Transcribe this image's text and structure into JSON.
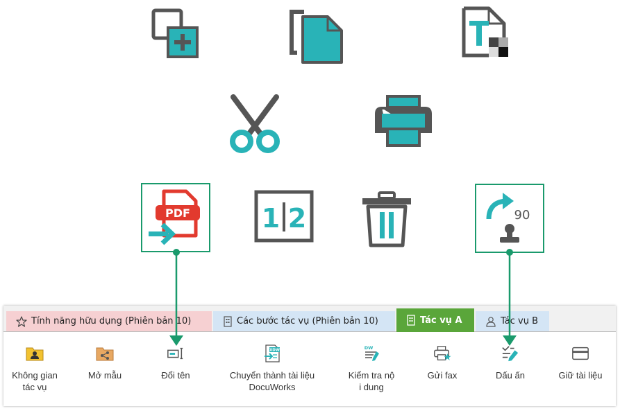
{
  "icons": {
    "colors": {
      "teal": "#29b3b7",
      "gray": "#555555",
      "red": "#e23a2e",
      "green": "#1a9a6c"
    },
    "pdf_label": "PDF",
    "split_left": "1",
    "split_right": "2",
    "rotate_label": "90"
  },
  "tabs": [
    {
      "label": "Tính năng hữu dụng (Phiên bản 10)",
      "color": "#f6d0d2",
      "icon": "star-icon"
    },
    {
      "label": "Các bước tác vụ (Phiên bản 10)",
      "color": "#d4e5f5",
      "icon": "building-icon"
    },
    {
      "label": "Tác vụ A",
      "color": "#5aa63a",
      "icon": "building-icon",
      "active": true
    },
    {
      "label": "Tác vụ B",
      "color": "#d4e5f5",
      "icon": "user-icon"
    }
  ],
  "tools": [
    {
      "label": "Không gian\ntác vụ",
      "icon": "workspace-folder-icon"
    },
    {
      "label": "Mở mẫu",
      "icon": "shared-folder-icon"
    },
    {
      "label": "Đổi tên",
      "icon": "rename-icon"
    },
    {
      "label": "Chuyển thành tài liệu\nDocuWorks",
      "icon": "xdw-convert-icon"
    },
    {
      "label": "Kiểm tra nộ\ni dung",
      "icon": "content-check-icon"
    },
    {
      "label": "Gửi fax",
      "icon": "fax-icon"
    },
    {
      "label": "Dấu ấn",
      "icon": "stamp-icon"
    },
    {
      "label": "Giữ tài liệu",
      "icon": "hold-document-icon"
    }
  ],
  "tool_icon_text": {
    "xdw": "XDW",
    "dw": "DW"
  }
}
